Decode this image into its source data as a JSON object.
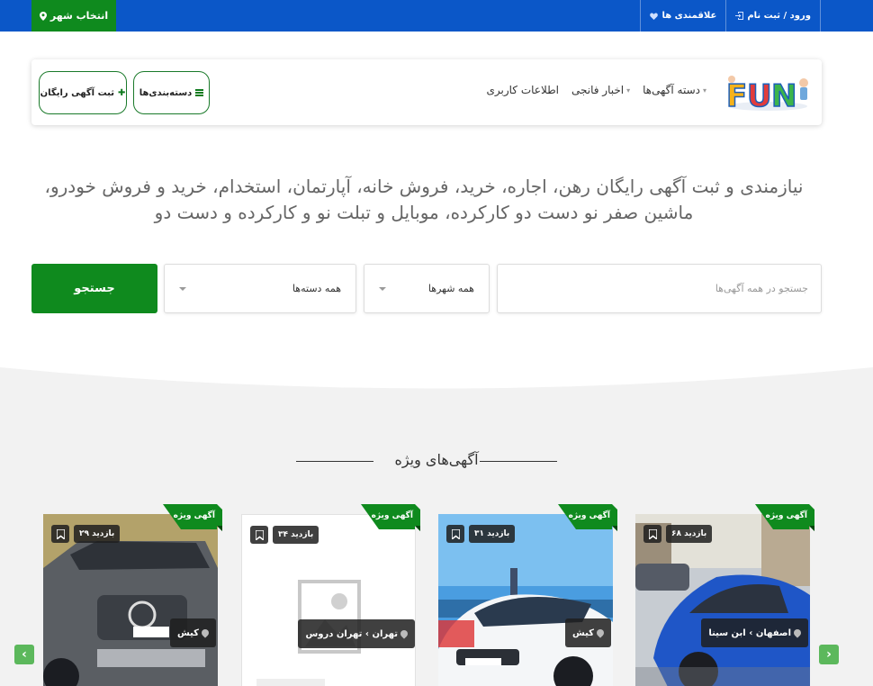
{
  "topbar": {
    "city_button": "انتخاب شهر",
    "links": [
      {
        "label": "ورود / ثبت نام",
        "icon": "login-icon"
      },
      {
        "label": "علاقمندی ها",
        "icon": "heart-icon"
      }
    ]
  },
  "header": {
    "logo_text": "FUN",
    "nav": [
      {
        "label": "دسته آگهی‌ها",
        "caret": true
      },
      {
        "label": "اخبار فانجی",
        "caret": true
      },
      {
        "label": "اطلاعات کاربری",
        "caret": false
      }
    ],
    "categories_button": "دسته‌بندی‌ها",
    "post_ad_button": "ثبت آگهی رایگان"
  },
  "hero": {
    "title": "نیازمندی و ثبت آگهی رایگان رهن، اجاره، خرید، فروش خانه، آپارتمان، استخدام، خرید و فروش خودرو، ماشین صفر نو دست دو کارکرده، موبایل و تبلت نو و کارکرده و دست دو"
  },
  "search": {
    "placeholder": "جستجو در همه آگهی‌ها",
    "city_select": "همه شهرها",
    "category_select": "همه دسته‌ها",
    "button": "جستجو"
  },
  "featured": {
    "title": "آگهی‌های ویژه",
    "cards": [
      {
        "badge": "آگهی ویژه",
        "views": "۶۸ بازدید",
        "location": "اصفهان › ابن سینا",
        "image": "blue-sports-car"
      },
      {
        "badge": "آگهی ویژه",
        "views": "۳۱ بازدید",
        "location": "کیش",
        "image": "white-bmw"
      },
      {
        "badge": "آگهی ویژه",
        "views": "۳۴ بازدید",
        "location": "تهران › تهران دروس",
        "image": "placeholder-image"
      },
      {
        "badge": "آگهی ویژه",
        "views": "۲۹ بازدید",
        "location": "کیش",
        "image": "grey-mercedes-pickup"
      }
    ]
  },
  "colors": {
    "blue": "#0b57c8",
    "green": "#0f8a1e",
    "light_green": "#5cb85c"
  }
}
